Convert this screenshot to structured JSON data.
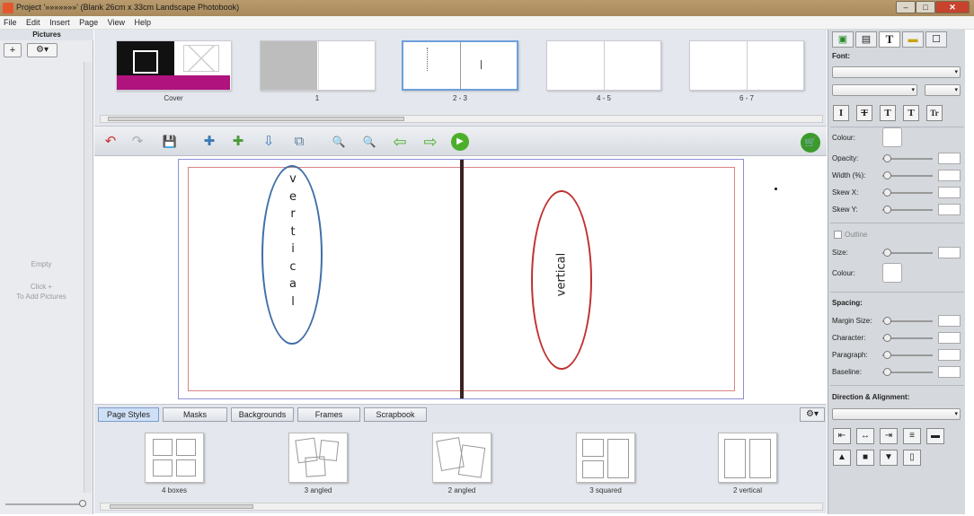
{
  "window": {
    "title": "Project '»»»»»»»' (Blank 26cm x 33cm Landscape Photobook)",
    "minimize": "–",
    "maximize": "□",
    "close": "✕"
  },
  "menu": [
    "File",
    "Edit",
    "Insert",
    "Page",
    "View",
    "Help"
  ],
  "left_panel": {
    "header": "Pictures",
    "add_icon": "+",
    "gear_icon": "⚙▾",
    "empty_title": "Empty",
    "empty_hint_1": "Click +",
    "empty_hint_2": "To Add Pictures"
  },
  "thumbnails": [
    {
      "label": "Cover",
      "selected": false
    },
    {
      "label": "1",
      "selected": false
    },
    {
      "label": "2 - 3",
      "selected": true
    },
    {
      "label": "4 - 5",
      "selected": false
    },
    {
      "label": "6 - 7",
      "selected": false
    }
  ],
  "toolbar_icons": {
    "undo": "↶",
    "redo": "↷",
    "save": "💾",
    "add_picture": "✚",
    "add_text": "✚",
    "insert_page": "⇩",
    "copy_page": "⧉",
    "zoom_out": "🔍",
    "zoom_in": "🔍",
    "back": "⇦",
    "forward": "⇨",
    "play": "▶",
    "cart": "🛒"
  },
  "canvas": {
    "left_text_letters": [
      "v",
      "e",
      "r",
      "t",
      "i",
      "c",
      "a",
      "l"
    ],
    "right_text": "vertical",
    "left_oval_color": "#3f6fa8",
    "right_oval_color": "#c03030"
  },
  "bottom_tabs": [
    "Page Styles",
    "Masks",
    "Backgrounds",
    "Frames",
    "Scrapbook"
  ],
  "active_tab": "Page Styles",
  "tab_gear": "⚙▾",
  "page_styles": [
    "4 boxes",
    "3 angled",
    "2 angled",
    "3 squared",
    "2 vertical"
  ],
  "right_panel": {
    "tab_text": "T",
    "font_label": "Font:",
    "format_buttons": [
      "I",
      "T",
      "T",
      "T",
      "Tr"
    ],
    "colour_label": "Colour:",
    "opacity_label": "Opacity:",
    "width_label": "Width (%):",
    "skew_x_label": "Skew X:",
    "skew_y_label": "Skew Y:",
    "outline_label": "Outline",
    "size_label": "Size:",
    "outline_colour_label": "Colour:",
    "spacing_label": "Spacing:",
    "margin_size_label": "Margin Size:",
    "character_label": "Character:",
    "paragraph_label": "Paragraph:",
    "baseline_label": "Baseline:",
    "direction_label": "Direction & Alignment:"
  }
}
